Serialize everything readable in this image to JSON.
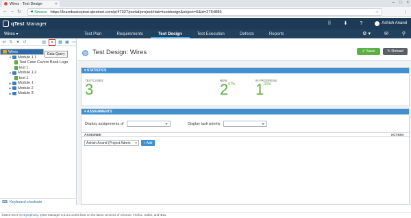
{
  "browser": {
    "tab_title": "Wires - Test Design",
    "secure_label": "Secure",
    "url": "https://learnbasicqtest.qtestnet.com/p/47327/portal/project#tab=testdesign&object=6&id=2754886",
    "window_controls": [
      "–",
      "□",
      "×"
    ]
  },
  "app": {
    "name": "qTest",
    "name2": "Manager",
    "user": "Ashish Anand"
  },
  "project": {
    "name": "Wires ▾"
  },
  "tabs": [
    {
      "label": "Test Plan"
    },
    {
      "label": "Requirements"
    },
    {
      "label": "Test Design"
    },
    {
      "label": "Test Execution"
    },
    {
      "label": "Defects"
    },
    {
      "label": "Reports"
    }
  ],
  "left": {
    "tooltip": "Data Query",
    "tree": [
      {
        "label": "Wires",
        "level": 0,
        "type": "root",
        "sel": true
      },
      {
        "label": "Module 1.1",
        "level": 1,
        "type": "folder",
        "exp": "▼"
      },
      {
        "label": "Test Case Covers Bank Logo",
        "level": 2,
        "type": "tc"
      },
      {
        "label": "test 1",
        "level": 2,
        "type": "tc"
      },
      {
        "label": "Module 1.2",
        "level": 1,
        "type": "folder",
        "exp": "▼"
      },
      {
        "label": "test 1",
        "level": 2,
        "type": "tc"
      },
      {
        "label": "Module 1",
        "level": 1,
        "type": "folder",
        "exp": "▶"
      },
      {
        "label": "Module 2",
        "level": 1,
        "type": "folder",
        "exp": "▶"
      },
      {
        "label": "Module 3",
        "level": 1,
        "type": "folder",
        "exp": "▶"
      }
    ],
    "keyboard": "Keyboard shortcuts"
  },
  "main": {
    "title": "Test Design: Wires",
    "save": "Save",
    "reload": "Reload",
    "stats": {
      "header": "STATISTICS",
      "testcases_label": "TESTCASES",
      "testcases": "3",
      "new_label": "NEW",
      "new": "2",
      "new_pct": "67%",
      "prog_label": "IN PROGRESS",
      "prog": "1",
      "prog_pct": "33%"
    },
    "assign": {
      "header": "ASSIGNMENTS",
      "display_of": "Display assignments of",
      "display_prio": "Display task priority",
      "col_assignee": "ASSIGNEE",
      "col_action": "ACTION",
      "assignee_value": "Ashish Anand (Project Admin",
      "add": "+ Add"
    }
  },
  "footer": {
    "copyright": "©2010-2017",
    "company": "QASymphony",
    "text": ". qTest Manager 8.5.3.2 works best on the latest versions of Chrome, Firefox, Safari, and IE11."
  }
}
